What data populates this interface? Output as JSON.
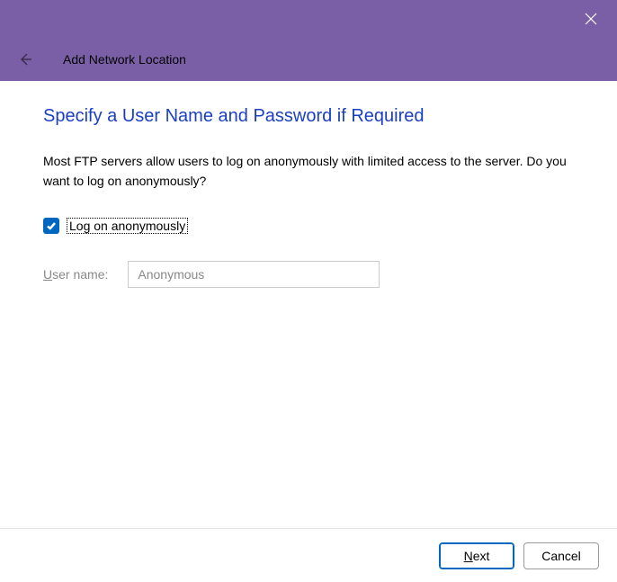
{
  "titlebar": {
    "close_label": "Close"
  },
  "header": {
    "title": "Add Network Location"
  },
  "page": {
    "title": "Specify a User Name and Password if Required",
    "description": "Most FTP servers allow users to log on anonymously with limited access to the server.  Do you want to log on anonymously?"
  },
  "form": {
    "anonymous_checkbox_label": "Log on anonymously",
    "anonymous_checked": true,
    "username_label_pre": "U",
    "username_label_rest": "ser name:",
    "username_value": "Anonymous"
  },
  "footer": {
    "next_pre": "N",
    "next_rest": "ext",
    "cancel_label": "Cancel"
  }
}
